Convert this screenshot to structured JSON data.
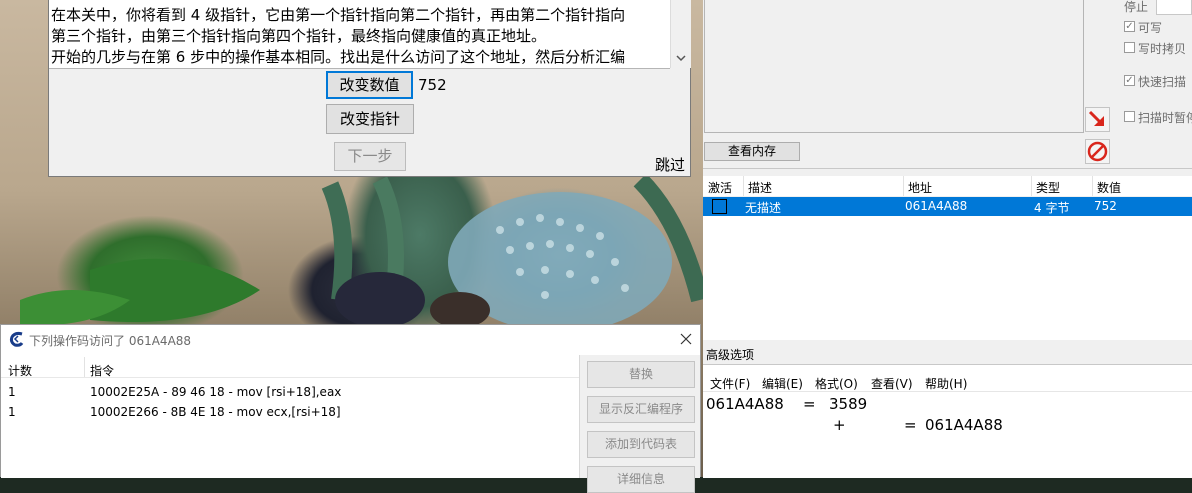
{
  "tutorial": {
    "lines": [
      "在本关中，你将看到 4 级指针，它由第一个指针指向第二个指针，再由第二个指针指向",
      "第三个指针，由第三个指针指向第四个指针，最终指向健康值的真正地址。",
      "开始的几步与在第 6 步中的操作基本相同。找出是什么访问了这个地址，然后分析汇编"
    ],
    "change_value_label": "改变数值",
    "value": "752",
    "change_pointer_label": "改变指针",
    "next_label": "下一步",
    "skip_label": "跳过"
  },
  "scan_options": {
    "stop_label": "停止",
    "writable_label": "可写",
    "copy_on_write_label": "写时拷贝",
    "fast_scan_label": "快速扫描",
    "pause_label": "扫描时暂停"
  },
  "view_memory_label": "查看内存",
  "address_table": {
    "headers": [
      "激活",
      "描述",
      "地址",
      "类型",
      "数值"
    ],
    "rows": [
      {
        "description": "无描述",
        "address": "061A4A88",
        "type": "4 字节",
        "value": "752"
      }
    ]
  },
  "advanced_label": "高级选项",
  "bottom_right": {
    "menu": [
      "文件(F)",
      "编辑(E)",
      "格式(O)",
      "查看(V)",
      "帮助(H)"
    ],
    "expr1": {
      "left": "061A4A88",
      "eq": "=",
      "right": "3589"
    },
    "expr2": {
      "plus": "+",
      "eq": "=",
      "right": "061A4A88"
    }
  },
  "access_dialog": {
    "title": "下列操作码访问了 061A4A88",
    "headers": [
      "计数",
      "指令"
    ],
    "rows": [
      {
        "count": "1",
        "instruction": "10002E25A - 89 46 18  - mov [rsi+18],eax"
      },
      {
        "count": "1",
        "instruction": "10002E266 - 8B 4E 18  - mov ecx,[rsi+18]"
      }
    ],
    "buttons": [
      "替换",
      "显示反汇编程序",
      "添加到代码表",
      "详细信息"
    ]
  },
  "colors": {
    "selection": "#0078d7",
    "dialog_bg": "#f0f0f0",
    "arrow_red": "#d9261c"
  }
}
